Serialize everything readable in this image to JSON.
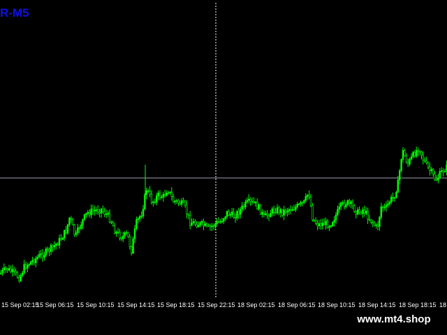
{
  "chart": {
    "symbol_label": "R-M5",
    "background": "#000000",
    "candle_color": "#00ff00",
    "crosshair_color": "#ffffff",
    "hline_color": "#a0a0b0"
  },
  "time_axis": {
    "labels": [
      "15 Sep 02:15",
      "15 Sep 06:15",
      "15 Sep 10:15",
      "15 Sep 14:15",
      "15 Sep 18:15",
      "15 Sep 22:15",
      "18 Sep 02:15",
      "18 Sep 06:15",
      "18 Sep 10:15",
      "18 Sep 14:15",
      "18 Sep 18:15",
      "18"
    ]
  },
  "watermark": {
    "text": "www.mt4.shop"
  }
}
